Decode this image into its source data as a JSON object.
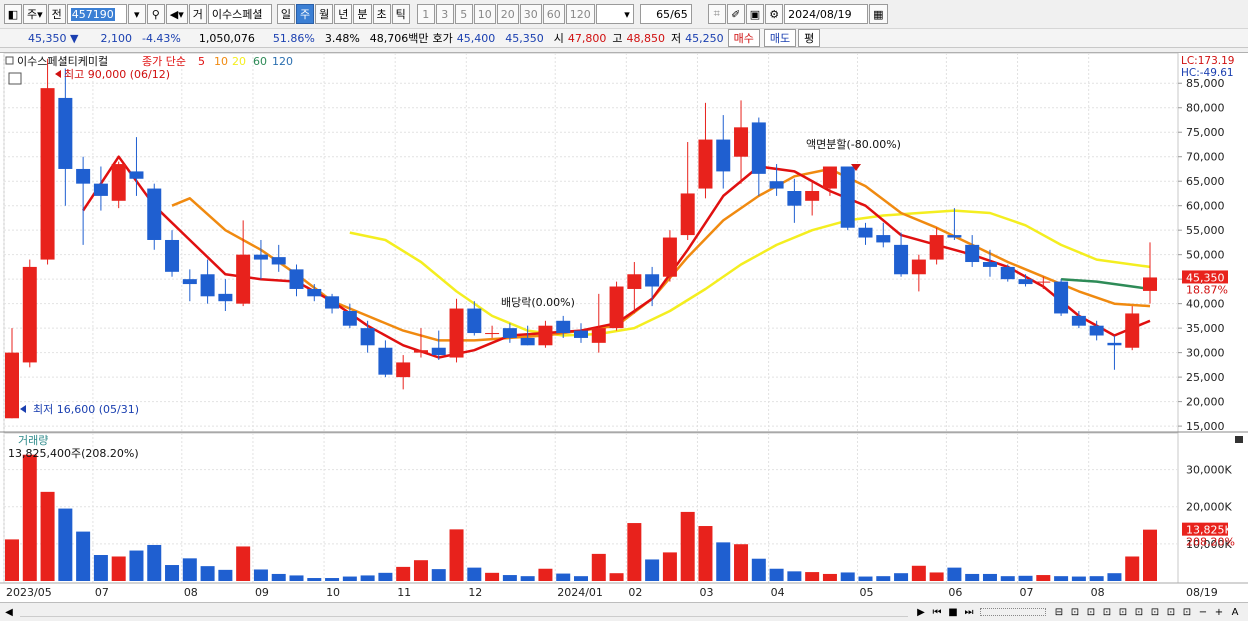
{
  "toolbar": {
    "period_btn": "주",
    "jeon_btn": "전",
    "code": "457190",
    "name": "이수스페셜",
    "geo_btn": "거",
    "periods": [
      "일",
      "주",
      "월",
      "년",
      "분",
      "초",
      "틱"
    ],
    "selected_period": "주",
    "minute_opts": [
      "1",
      "3",
      "5",
      "10",
      "20",
      "30",
      "60",
      "120"
    ],
    "count": "65",
    "count_total": "/65",
    "date": "2024/08/19"
  },
  "quote": {
    "price": "45,350",
    "arrow": "▼",
    "change": "2,100",
    "change_pct": "-4.43%",
    "volume": "1,050,076",
    "vol_ratio": "51.86%",
    "turnover": "3.48%",
    "amount": "48,706백만",
    "hoga_label": "호가",
    "hoga_ask": "45,400",
    "hoga_bid": "45,350",
    "open_label": "시",
    "open": "47,800",
    "high_label": "고",
    "high": "48,850",
    "low_label": "저",
    "low": "45,250",
    "buy_btn": "매수",
    "sell_btn": "매도",
    "eval_btn": "평"
  },
  "legend": {
    "stock_name": "이수스페셜티케미컬",
    "ma_title": "종가 단순",
    "ma_periods": [
      "5",
      "10",
      "20",
      "60",
      "120"
    ],
    "lc": "LC:173.19",
    "hc": "HC:-49.61",
    "volume_title": "거래량",
    "volume_value": "13,825,400주(208.20%)"
  },
  "annotations": {
    "high": "최고 90,000 (06/12)",
    "low": "최저 16,600 (05/31)",
    "dividend": "배당락(0.00%)",
    "split": "액면분할(-80.00%)"
  },
  "price_axis": {
    "ticks": [
      "85,000",
      "80,000",
      "75,000",
      "70,000",
      "65,000",
      "60,000",
      "55,000",
      "50,000",
      "45,000",
      "40,000",
      "35,000",
      "30,000",
      "25,000",
      "20,000",
      "15,000"
    ],
    "current_label": "45,350",
    "current_pct": "18.87%"
  },
  "volume_axis": {
    "ticks": [
      "30,000K",
      "20,000K",
      "10,000K"
    ],
    "current_label": "13,825K",
    "current_pct": "208.20%"
  },
  "date_axis": {
    "labels": [
      "2023/05",
      "07",
      "08",
      "09",
      "10",
      "11",
      "12",
      "2024/01",
      "02",
      "03",
      "04",
      "05",
      "06",
      "07",
      "08"
    ],
    "right_label": "08/19"
  },
  "colors": {
    "up": "#e8221c",
    "down": "#1f5fd0",
    "ma5": "#e01010",
    "ma10": "#f08a10",
    "ma20": "#f4ee20",
    "ma60": "#2e8b57",
    "ma120": "#2b6fb0",
    "grid": "#e2e2e2"
  },
  "chart_data": {
    "type": "candlestick",
    "title": "이수스페셜티케미컬",
    "price_range": [
      14000,
      87500
    ],
    "volume_range_k": [
      0,
      35000
    ],
    "candles": [
      {
        "date": "2023/05",
        "open": 16600,
        "high": 35000,
        "low": 16600,
        "close": 30000,
        "vol": 11200
      },
      {
        "date": "2023/06 w1",
        "open": 28000,
        "high": 49000,
        "low": 27000,
        "close": 47500,
        "vol": 34000
      },
      {
        "date": "2023/06 w2",
        "open": 49000,
        "high": 90000,
        "low": 48000,
        "close": 84000,
        "vol": 24000
      },
      {
        "date": "2023/06 w3",
        "open": 82000,
        "high": 88000,
        "low": 60000,
        "close": 67500,
        "vol": 19500
      },
      {
        "date": "2023/06 w4",
        "open": 67500,
        "high": 70000,
        "low": 52000,
        "close": 64500,
        "vol": 13300
      },
      {
        "date": "2023/07 w1",
        "open": 64500,
        "high": 68000,
        "low": 59000,
        "close": 62000,
        "vol": 7000
      },
      {
        "date": "2023/07 w2",
        "open": 61000,
        "high": 69000,
        "low": 59500,
        "close": 68500,
        "vol": 6600
      },
      {
        "date": "2023/07 w3",
        "open": 67000,
        "high": 74000,
        "low": 62000,
        "close": 65500,
        "vol": 8200
      },
      {
        "date": "2023/07 w4",
        "open": 63500,
        "high": 64500,
        "low": 51000,
        "close": 53000,
        "vol": 9700
      },
      {
        "date": "2023/08 w1",
        "open": 53000,
        "high": 55000,
        "low": 45500,
        "close": 46500,
        "vol": 4300
      },
      {
        "date": "2023/08 w2",
        "open": 45000,
        "high": 47000,
        "low": 40500,
        "close": 44000,
        "vol": 6100
      },
      {
        "date": "2023/08 w3",
        "open": 46000,
        "high": 49000,
        "low": 40000,
        "close": 41500,
        "vol": 4000
      },
      {
        "date": "2023/08 w4",
        "open": 42000,
        "high": 45000,
        "low": 38500,
        "close": 40500,
        "vol": 3000
      },
      {
        "date": "2023/09 w1",
        "open": 40000,
        "high": 57000,
        "low": 39500,
        "close": 50000,
        "vol": 9300
      },
      {
        "date": "2023/09 w2",
        "open": 50000,
        "high": 53000,
        "low": 45000,
        "close": 49000,
        "vol": 3100
      },
      {
        "date": "2023/09 w3",
        "open": 49500,
        "high": 52000,
        "low": 46500,
        "close": 48000,
        "vol": 1900
      },
      {
        "date": "2023/09 w4",
        "open": 47000,
        "high": 48000,
        "low": 41500,
        "close": 43000,
        "vol": 1500
      },
      {
        "date": "2023/10 w1",
        "open": 43000,
        "high": 44000,
        "low": 40500,
        "close": 41500,
        "vol": 800
      },
      {
        "date": "2023/10 w2",
        "open": 41500,
        "high": 42000,
        "low": 38000,
        "close": 39000,
        "vol": 800
      },
      {
        "date": "2023/10 w3",
        "open": 38500,
        "high": 40000,
        "low": 35000,
        "close": 35500,
        "vol": 1200
      },
      {
        "date": "2023/10 w4",
        "open": 35000,
        "high": 36500,
        "low": 30000,
        "close": 31500,
        "vol": 1500
      },
      {
        "date": "2023/11 w1",
        "open": 31000,
        "high": 32500,
        "low": 25000,
        "close": 25500,
        "vol": 2200
      },
      {
        "date": "2023/11 w2",
        "open": 25000,
        "high": 29500,
        "low": 22500,
        "close": 28000,
        "vol": 3800
      },
      {
        "date": "2023/11 w3",
        "open": 30000,
        "high": 35000,
        "low": 29000,
        "close": 30500,
        "vol": 5600
      },
      {
        "date": "2023/11 w4",
        "open": 31000,
        "high": 34500,
        "low": 28500,
        "close": 29500,
        "vol": 3200
      },
      {
        "date": "2023/12 w1",
        "open": 29000,
        "high": 41000,
        "low": 28000,
        "close": 39000,
        "vol": 13900
      },
      {
        "date": "2023/12 w2",
        "open": 39000,
        "high": 40500,
        "low": 33500,
        "close": 34000,
        "vol": 3600
      },
      {
        "date": "2023/12 w3",
        "open": 34000,
        "high": 35500,
        "low": 33000,
        "close": 34000,
        "vol": 2200
      },
      {
        "date": "2023/12 w4",
        "open": 35000,
        "high": 36000,
        "low": 32000,
        "close": 33000,
        "vol": 1600
      },
      {
        "date": "2024/01 w1",
        "open": 33000,
        "high": 35500,
        "low": 31500,
        "close": 31500,
        "vol": 1300
      },
      {
        "date": "2024/01 w2",
        "open": 31500,
        "high": 36500,
        "low": 31000,
        "close": 35500,
        "vol": 3300
      },
      {
        "date": "2024/01 w3",
        "open": 36500,
        "high": 37500,
        "low": 33000,
        "close": 34000,
        "vol": 2000
      },
      {
        "date": "2024/01 w4",
        "open": 34500,
        "high": 36000,
        "low": 32000,
        "close": 33000,
        "vol": 1300
      },
      {
        "date": "2024/02 w1",
        "open": 32000,
        "high": 42000,
        "low": 30000,
        "close": 35000,
        "vol": 7300
      },
      {
        "date": "2024/02 w2",
        "open": 35000,
        "high": 44500,
        "low": 34500,
        "close": 43500,
        "vol": 2100
      },
      {
        "date": "2024/02 w3",
        "open": 43000,
        "high": 48500,
        "low": 38000,
        "close": 46000,
        "vol": 15600
      },
      {
        "date": "2024/02 w4",
        "open": 46000,
        "high": 47500,
        "low": 39500,
        "close": 43500,
        "vol": 5800
      },
      {
        "date": "2024/03 w1",
        "open": 45500,
        "high": 55000,
        "low": 44500,
        "close": 53500,
        "vol": 7700
      },
      {
        "date": "2024/03 w2",
        "open": 54000,
        "high": 73000,
        "low": 53000,
        "close": 62500,
        "vol": 18600
      },
      {
        "date": "2024/03 w3",
        "open": 63500,
        "high": 81000,
        "low": 61500,
        "close": 73500,
        "vol": 14800
      },
      {
        "date": "2024/03 w4",
        "open": 73500,
        "high": 78500,
        "low": 63500,
        "close": 67000,
        "vol": 10400
      },
      {
        "date": "2024/04 w1",
        "open": 70000,
        "high": 81500,
        "low": 64500,
        "close": 76000,
        "vol": 9900
      },
      {
        "date": "2024/04 w2",
        "open": 77000,
        "high": 78000,
        "low": 62000,
        "close": 66500,
        "vol": 6000
      },
      {
        "date": "2024/04 w3",
        "open": 65000,
        "high": 68500,
        "low": 62000,
        "close": 63500,
        "vol": 3300
      },
      {
        "date": "2024/04 w4",
        "open": 63000,
        "high": 65500,
        "low": 56500,
        "close": 60000,
        "vol": 2600
      },
      {
        "date": "2024/05 w1",
        "open": 61000,
        "high": 65000,
        "low": 58000,
        "close": 63000,
        "vol": 2400
      },
      {
        "date": "2024/05 w2",
        "open": 63500,
        "high": 68000,
        "low": 62000,
        "close": 68000,
        "vol": 1900
      },
      {
        "date": "2024/05 w3",
        "open": 68000,
        "high": 68000,
        "low": 55000,
        "close": 55500,
        "vol": 2300
      },
      {
        "date": "2024/05 w4",
        "open": 55500,
        "high": 56500,
        "low": 52000,
        "close": 53500,
        "vol": 1200
      },
      {
        "date": "2024/06 w1",
        "open": 54000,
        "high": 56500,
        "low": 51500,
        "close": 52500,
        "vol": 1300
      },
      {
        "date": "2024/06 w2",
        "open": 52000,
        "high": 54500,
        "low": 45500,
        "close": 46000,
        "vol": 2100
      },
      {
        "date": "2024/06 w3",
        "open": 46000,
        "high": 50000,
        "low": 42500,
        "close": 49000,
        "vol": 4100
      },
      {
        "date": "2024/06 w4",
        "open": 49000,
        "high": 55500,
        "low": 48000,
        "close": 54000,
        "vol": 2300
      },
      {
        "date": "2024/07 w1",
        "open": 54000,
        "high": 59500,
        "low": 53000,
        "close": 53500,
        "vol": 3600
      },
      {
        "date": "2024/07 w2",
        "open": 52000,
        "high": 54000,
        "low": 47500,
        "close": 48500,
        "vol": 1900
      },
      {
        "date": "2024/07 w3",
        "open": 48500,
        "high": 51000,
        "low": 45500,
        "close": 47500,
        "vol": 1900
      },
      {
        "date": "2024/07 w4",
        "open": 47500,
        "high": 48000,
        "low": 44500,
        "close": 45000,
        "vol": 1300
      },
      {
        "date": "2024/08 w1",
        "open": 45000,
        "high": 46000,
        "low": 43500,
        "close": 44000,
        "vol": 1400
      },
      {
        "date": "2024/08 w2",
        "open": 44500,
        "high": 45500,
        "low": 43000,
        "close": 44500,
        "vol": 1600
      },
      {
        "date": "2024/08 w3",
        "open": 44500,
        "high": 45000,
        "low": 37500,
        "close": 38000,
        "vol": 1300
      },
      {
        "date": "2024/08 w4",
        "open": 37500,
        "high": 38500,
        "low": 35000,
        "close": 35500,
        "vol": 1200
      },
      {
        "date": "2024/08 w5",
        "open": 35500,
        "high": 36500,
        "low": 32500,
        "close": 33500,
        "vol": 1300
      },
      {
        "date": "2024/08 w6",
        "open": 32000,
        "high": 33500,
        "low": 26500,
        "close": 31500,
        "vol": 2100
      },
      {
        "date": "2024/08 w7",
        "open": 31000,
        "high": 39500,
        "low": 30500,
        "close": 38000,
        "vol": 6600
      },
      {
        "date": "2024/08/19",
        "open": 42600,
        "high": 52500,
        "low": 40000,
        "close": 45350,
        "vol": 13825
      }
    ],
    "ma5": [
      [
        4,
        59000
      ],
      [
        6,
        70000
      ],
      [
        8,
        60000
      ],
      [
        10,
        53000
      ],
      [
        12,
        46000
      ],
      [
        14,
        45000
      ],
      [
        16,
        44500
      ],
      [
        18,
        40500
      ],
      [
        20,
        35500
      ],
      [
        22,
        31500
      ],
      [
        24,
        29000
      ],
      [
        26,
        30500
      ],
      [
        28,
        33500
      ],
      [
        30,
        34000
      ],
      [
        32,
        34500
      ],
      [
        34,
        36000
      ],
      [
        36,
        41000
      ],
      [
        38,
        51000
      ],
      [
        40,
        62000
      ],
      [
        42,
        68000
      ],
      [
        44,
        67000
      ],
      [
        46,
        63000
      ],
      [
        48,
        60000
      ],
      [
        50,
        54000
      ],
      [
        52,
        52000
      ],
      [
        54,
        50000
      ],
      [
        56,
        47500
      ],
      [
        58,
        43500
      ],
      [
        60,
        37500
      ],
      [
        62,
        33500
      ],
      [
        64,
        36500
      ]
    ],
    "ma10": [
      [
        9,
        60000
      ],
      [
        10,
        61500
      ],
      [
        12,
        55000
      ],
      [
        14,
        51000
      ],
      [
        16,
        46000
      ],
      [
        18,
        40500
      ],
      [
        20,
        37500
      ],
      [
        22,
        34500
      ],
      [
        24,
        32500
      ],
      [
        26,
        32500
      ],
      [
        28,
        33000
      ],
      [
        30,
        33500
      ],
      [
        32,
        34500
      ],
      [
        34,
        35500
      ],
      [
        36,
        41000
      ],
      [
        38,
        49500
      ],
      [
        40,
        57000
      ],
      [
        42,
        62000
      ],
      [
        44,
        66000
      ],
      [
        46,
        67500
      ],
      [
        48,
        64000
      ],
      [
        50,
        58500
      ],
      [
        52,
        55500
      ],
      [
        54,
        52000
      ],
      [
        56,
        48500
      ],
      [
        58,
        45500
      ],
      [
        60,
        42500
      ],
      [
        62,
        40000
      ],
      [
        64,
        39500
      ]
    ],
    "ma20": [
      [
        19,
        54500
      ],
      [
        21,
        53000
      ],
      [
        23,
        48500
      ],
      [
        25,
        42500
      ],
      [
        27,
        37500
      ],
      [
        29,
        34500
      ],
      [
        31,
        33500
      ],
      [
        33,
        33800
      ],
      [
        35,
        35000
      ],
      [
        37,
        38500
      ],
      [
        39,
        43000
      ],
      [
        41,
        48000
      ],
      [
        43,
        52000
      ],
      [
        45,
        55000
      ],
      [
        47,
        57000
      ],
      [
        49,
        58000
      ],
      [
        51,
        58500
      ],
      [
        53,
        59000
      ],
      [
        55,
        58500
      ],
      [
        57,
        56000
      ],
      [
        59,
        52000
      ],
      [
        61,
        49000
      ],
      [
        64,
        47500
      ]
    ],
    "ma60": [
      [
        59,
        45000
      ],
      [
        61,
        44500
      ],
      [
        63,
        43500
      ],
      [
        64,
        43000
      ]
    ]
  }
}
